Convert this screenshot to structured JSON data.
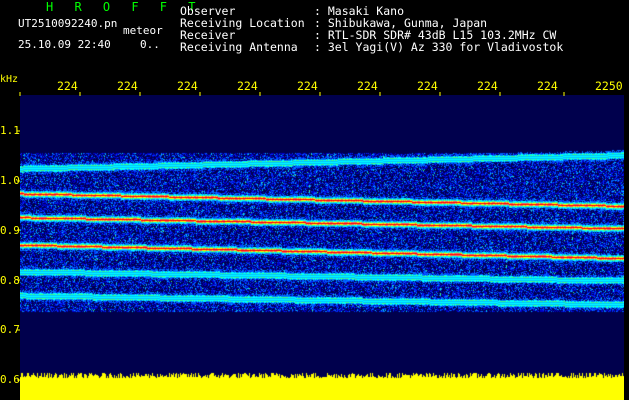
{
  "header": {
    "app_title": "H R O F F T",
    "file_name": "UT2510092240.pn",
    "mode_label": "meteor",
    "date_time": "25.10.09 22:40",
    "zero_label": "0..",
    "info": [
      {
        "key": "Observer",
        "value": ": Masaki Kano"
      },
      {
        "key": "Receiving Location",
        "value": ": Shibukawa, Gunma, Japan"
      },
      {
        "key": "Receiver",
        "value": ": RTL-SDR SDR# 43dB L15 103.2MHz CW"
      },
      {
        "key": "Receiving Antenna",
        "value": ": 3el Yagi(V) Az 330 for Vladivostok"
      }
    ]
  },
  "chart_data": {
    "type": "heatmap",
    "y_unit_label": "kHz",
    "x_tick_labels": [
      "224",
      "224",
      "224",
      "224",
      "224",
      "224",
      "224",
      "224",
      "224",
      "2250"
    ],
    "y_tick_labels": [
      "1.1",
      "1.0",
      "0.9",
      "0.8",
      "0.7",
      "0.6"
    ],
    "ylim": [
      0.6,
      1.12
    ],
    "signal_lines_khz": [
      {
        "start": 1.025,
        "end": 1.052,
        "intensity": 0.85
      },
      {
        "start": 0.975,
        "end": 0.95,
        "intensity": 1.0
      },
      {
        "start": 0.927,
        "end": 0.905,
        "intensity": 1.0
      },
      {
        "start": 0.872,
        "end": 0.845,
        "intensity": 1.0
      },
      {
        "start": 0.818,
        "end": 0.8,
        "intensity": 0.75
      },
      {
        "start": 0.77,
        "end": 0.752,
        "intensity": 0.7
      }
    ],
    "colors": {
      "background": "#00004d",
      "noise": "#0000ff",
      "mid": "#00ffff",
      "peak": "#ff0000",
      "bottom_bar": "#ffff00",
      "axis": "#ffff00"
    }
  }
}
